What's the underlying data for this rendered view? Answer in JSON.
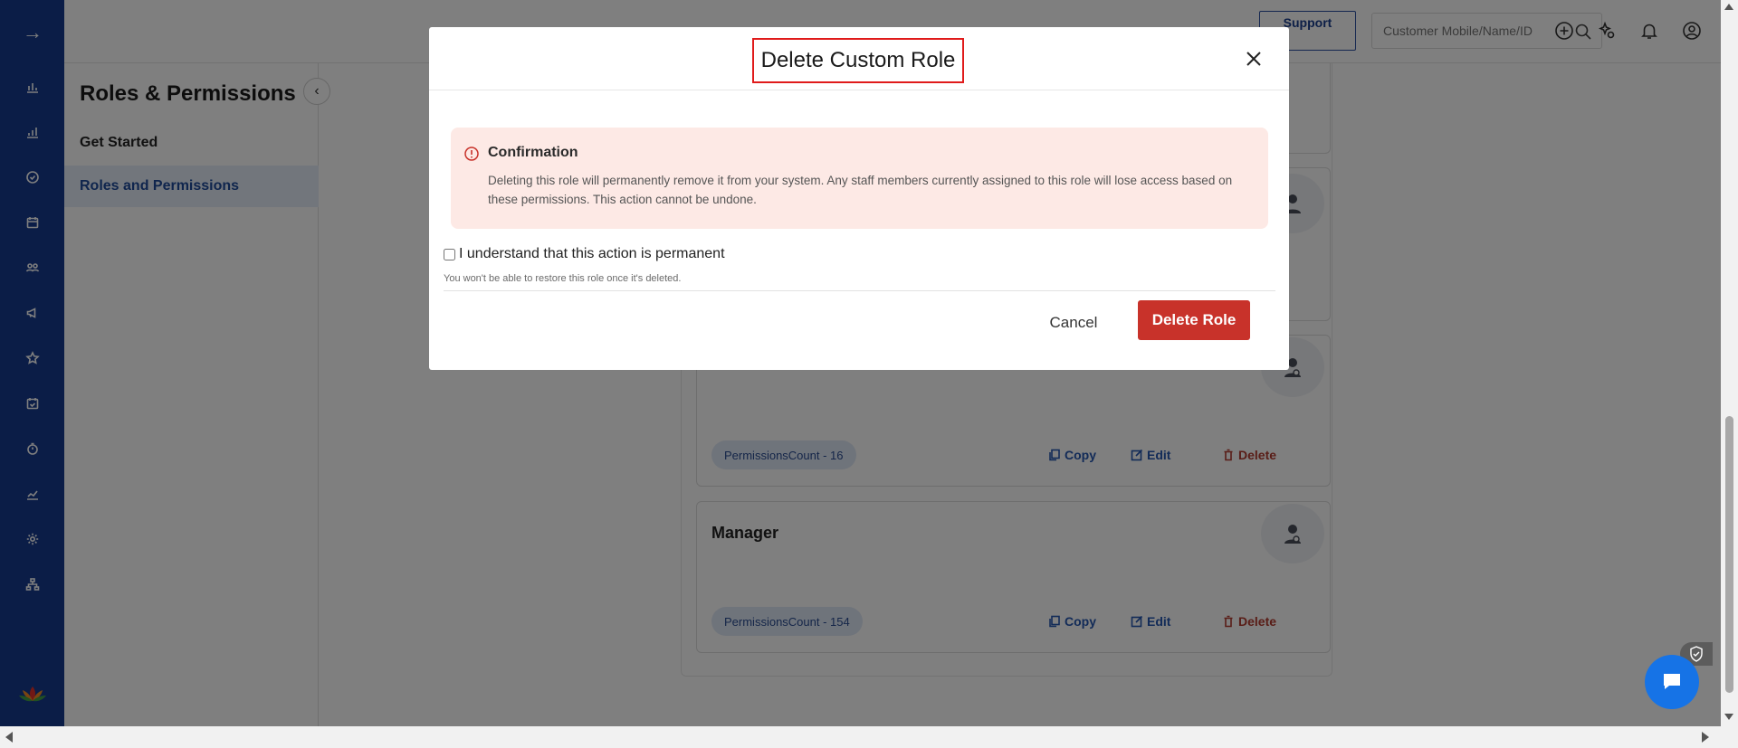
{
  "topbar": {
    "support_label": "Support",
    "search_placeholder": "Customer Mobile/Name/ID",
    "icons": [
      "plus-circle-icon",
      "sparkle-settings-icon",
      "bell-icon",
      "user-circle-icon"
    ]
  },
  "rail": {
    "icons": [
      "arrow-right-icon",
      "bar-chart-icon",
      "analytics-icon",
      "check-circle-icon",
      "calendar-icon",
      "customers-icon",
      "megaphone-icon",
      "star-icon",
      "calendar-check-icon",
      "timer-icon",
      "trend-icon",
      "gear-icon",
      "org-chart-icon",
      "lotus-logo-icon"
    ]
  },
  "subnav": {
    "title": "Roles & Permissions",
    "items": [
      {
        "label": "Get Started",
        "active": false
      },
      {
        "label": "Roles and Permissions",
        "active": true
      }
    ]
  },
  "roles": [
    {
      "name": "",
      "permissions": "PermissionsCount - 16"
    },
    {
      "name": "Manager",
      "permissions": "PermissionsCount - 154"
    }
  ],
  "role_actions": {
    "copy": "Copy",
    "edit": "Edit",
    "delete": "Delete"
  },
  "modal": {
    "title": "Delete Custom Role",
    "alert_title": "Confirmation",
    "alert_body": "Deleting this role will permanently remove it from your system. Any staff members currently assigned to this role will lose access based on these permissions. This action cannot be undone.",
    "checkbox_label": "I understand that this action is permanent",
    "checkbox_hint": "You won't be able to restore this role once it's deleted.",
    "cancel_label": "Cancel",
    "delete_label": "Delete Role"
  },
  "colors": {
    "rail": "#163a8f",
    "danger": "#c8322a",
    "alert_bg": "#fde9e5",
    "highlight_border": "#e01b1b",
    "chat": "#1673e6"
  }
}
